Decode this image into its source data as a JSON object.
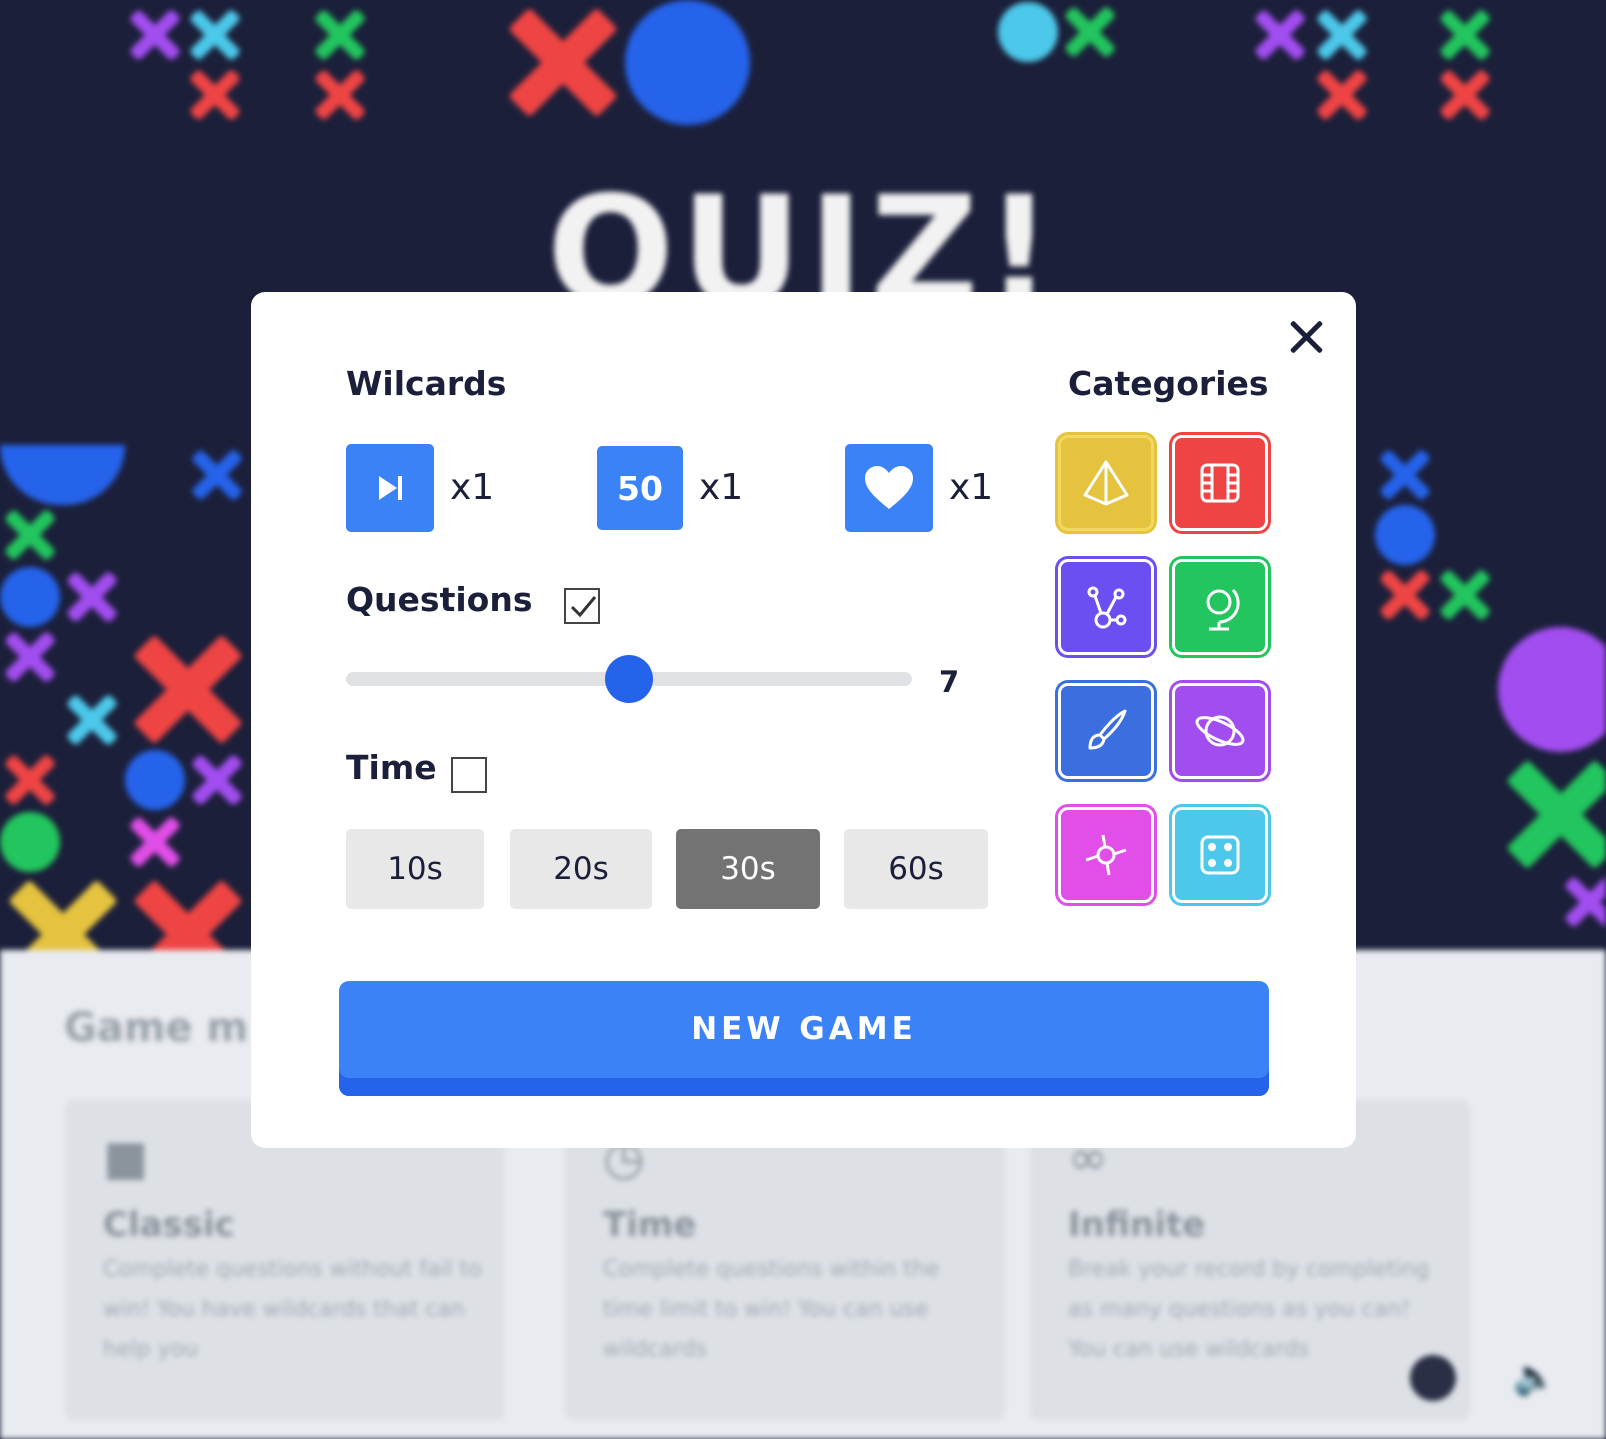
{
  "background": {
    "title": "QUIZ!",
    "section_title": "Game m",
    "modes": [
      {
        "title": "Classic",
        "description": "Complete questions without fail to win! You have wildcards that can help you"
      },
      {
        "title": "Time",
        "description": "Complete questions within the time limit to win! You can use wildcards"
      },
      {
        "title": "Infinite",
        "description": "Break your record by completing as many questions as you can! You can use wildcards"
      }
    ]
  },
  "modal": {
    "wildcards_label": "Wilcards",
    "wildcards": [
      {
        "icon": "skip-icon",
        "text": "",
        "count": "x1"
      },
      {
        "icon": "fifty-fifty-icon",
        "text": "50",
        "count": "x1"
      },
      {
        "icon": "heart-icon",
        "text": "",
        "count": "x1"
      }
    ],
    "questions_label": "Questions",
    "questions_checked": true,
    "questions_value": "7",
    "questions_slider_fraction": 0.5,
    "time_label": "Time",
    "time_checked": false,
    "time_options": [
      "10s",
      "20s",
      "30s",
      "60s"
    ],
    "time_selected": "30s",
    "categories_label": "Categories",
    "categories": [
      {
        "name": "pyramid-icon",
        "color": "#e5c33f"
      },
      {
        "name": "film-icon",
        "color": "#ef4444"
      },
      {
        "name": "molecule-icon",
        "color": "#6d4ef0"
      },
      {
        "name": "globe-icon",
        "color": "#22c55e"
      },
      {
        "name": "brush-icon",
        "color": "#3b6fe0"
      },
      {
        "name": "planet-icon",
        "color": "#a24df0"
      },
      {
        "name": "sport-icon",
        "color": "#e14ee8"
      },
      {
        "name": "dice-icon",
        "color": "#4cc8ea"
      }
    ],
    "new_game_label": "NEW GAME"
  },
  "colors": {
    "primary": "#3b82f6",
    "dark": "#1b1f3a"
  }
}
